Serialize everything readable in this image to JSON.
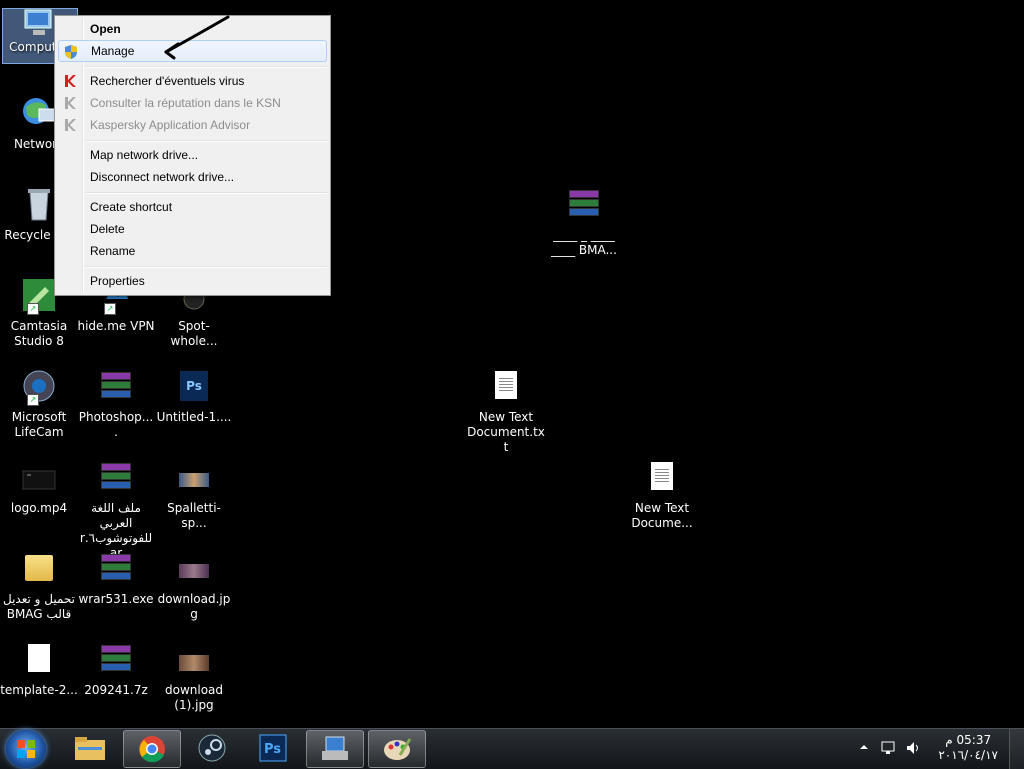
{
  "desktop": {
    "icons": {
      "computer": "Computer",
      "network": "Network",
      "recycle": "Recycle Bin",
      "camtasia": "Camtasia Studio 8",
      "lifecam": "Microsoft LifeCam",
      "logo": "logo.mp4",
      "tahmil": "تحميل و تعديل قالب BMAG",
      "template": "template-2...",
      "hideme": "hide.me VPN",
      "photoshop": "Photoshop....",
      "arabic_rar": "ملف اللغة العربي للفوتوشوب٦.rar",
      "wrar": "wrar531.exe",
      "z7": "209241.7z",
      "spot": "Spot-whole...",
      "untitled": "Untitled-1....",
      "spalletti": "Spalletti-sp...",
      "download": "download.jpg",
      "download1": "download (1).jpg",
      "bma_line1": "____ _ ____",
      "bma_line2": "____ BMA...",
      "newtext1": "New Text Document.txt",
      "newtext2": "New Text Docume..."
    },
    "annotation": "hand-drawn-arrow"
  },
  "context_menu": {
    "items": [
      {
        "label": "Open",
        "bold": true
      },
      {
        "label": "Manage",
        "icon": "shield-icon",
        "highlighted": true
      },
      {
        "label": "Rechercher d'éventuels virus",
        "icon": "kaspersky-icon"
      },
      {
        "label": "Consulter la réputation dans le KSN",
        "icon": "kaspersky-icon",
        "disabled": true
      },
      {
        "label": "Kaspersky Application Advisor",
        "icon": "kaspersky-icon",
        "disabled": true
      },
      {
        "label": "Map network drive..."
      },
      {
        "label": "Disconnect network drive..."
      },
      {
        "label": "Create shortcut"
      },
      {
        "label": "Delete"
      },
      {
        "label": "Rename"
      },
      {
        "label": "Properties"
      }
    ]
  },
  "taskbar": {
    "pinned": [
      "explorer-icon",
      "chrome-icon",
      "steam-icon",
      "photoshop-icon",
      "computer-management-icon",
      "paint-icon"
    ],
    "clock_time": "05:37 م",
    "clock_date": "٢٠١٦/٠٤/١٧",
    "accent": "#1b4f9c"
  }
}
